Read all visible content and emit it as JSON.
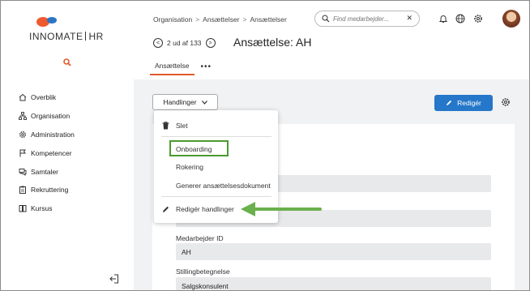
{
  "app": {
    "logo_left": "INNOMATE",
    "logo_right": "HR"
  },
  "sidebar": {
    "items": [
      {
        "label": "Overblik",
        "icon": "home-icon"
      },
      {
        "label": "Organisation",
        "icon": "org-chart-icon"
      },
      {
        "label": "Administration",
        "icon": "gear-icon"
      },
      {
        "label": "Kompetencer",
        "icon": "flag-icon"
      },
      {
        "label": "Samtaler",
        "icon": "chat-icon"
      },
      {
        "label": "Rekruttering",
        "icon": "clipboard-icon"
      },
      {
        "label": "Kursus",
        "icon": "book-icon"
      }
    ]
  },
  "header": {
    "breadcrumbs": [
      "Organisation",
      "Ansættelser",
      "Ansættelser"
    ],
    "search_placeholder": "Find medarbejder...",
    "pager_text": "2 ud af 133",
    "title": "Ansættelse: AH",
    "tabs": [
      {
        "label": "Ansættelse",
        "active": true
      }
    ],
    "tab_more": "•••"
  },
  "toolbar": {
    "actions_label": "Handlinger",
    "edit_label": "Redigér"
  },
  "menu": {
    "delete": "Slet",
    "onboarding": "Onboarding",
    "rotation": "Rokering",
    "generate_doc": "Generer ansættelsesdokument",
    "edit_actions": "Redigér handlinger"
  },
  "form": {
    "employee_id_label": "Medarbejder ID",
    "employee_id_value": "AH",
    "job_title_label": "Stillingbetegnelse",
    "job_title_value": "Salgskonsulent"
  },
  "colors": {
    "accent_orange": "#e05a2b",
    "primary_blue": "#2577c9",
    "highlight_green": "#4a9a2f"
  }
}
